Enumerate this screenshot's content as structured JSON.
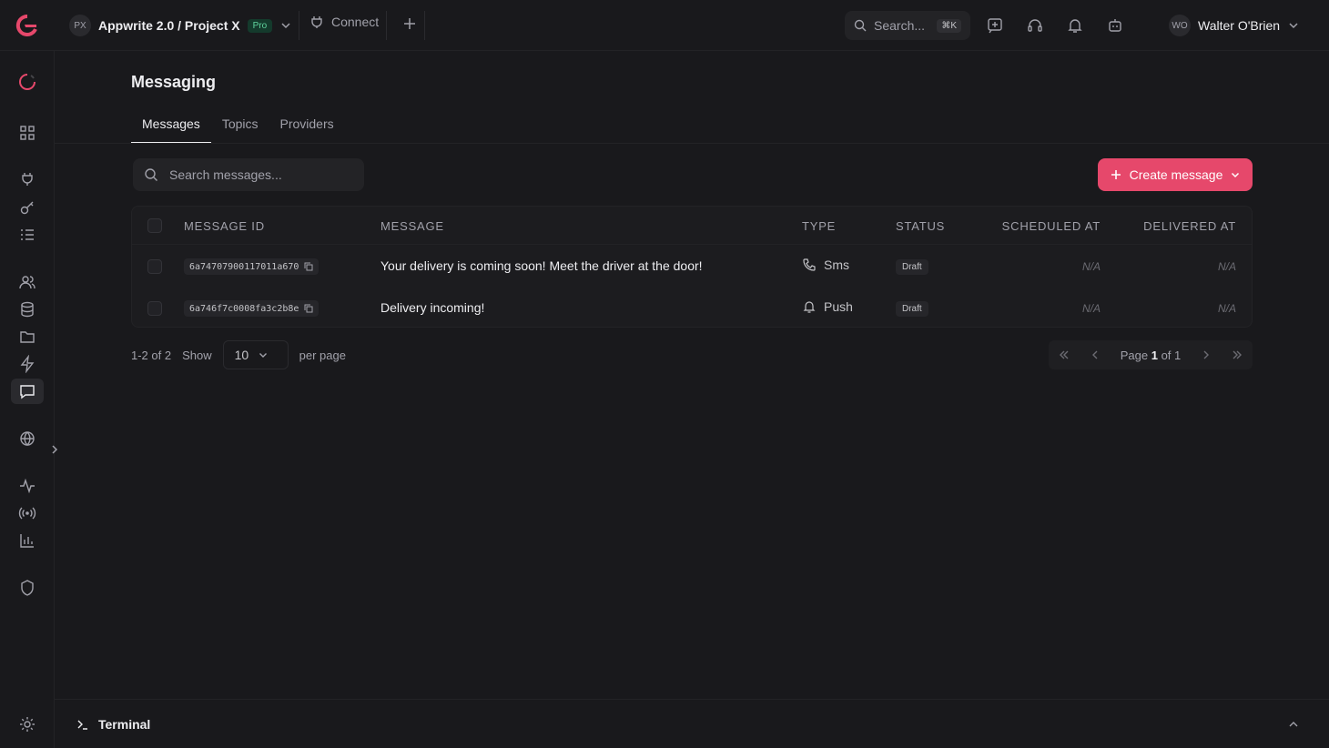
{
  "header": {
    "project_initials": "PX",
    "project_name": "Appwrite 2.0 / Project X",
    "plan_badge": "Pro",
    "connect_label": "Connect",
    "search_placeholder": "Search...",
    "search_shortcut": "⌘K",
    "user_initials": "WO",
    "user_name": "Walter O'Brien"
  },
  "page": {
    "title": "Messaging",
    "tabs": [
      {
        "label": "Messages",
        "active": true
      },
      {
        "label": "Topics",
        "active": false
      },
      {
        "label": "Providers",
        "active": false
      }
    ],
    "search_placeholder": "Search messages...",
    "create_label": "Create message"
  },
  "table": {
    "columns": [
      "MESSAGE ID",
      "MESSAGE",
      "TYPE",
      "STATUS",
      "SCHEDULED AT",
      "DELIVERED AT"
    ],
    "rows": [
      {
        "id": "6a74707900117011a670",
        "message": "Your delivery is coming soon! Meet the driver at the door!",
        "type": "Sms",
        "status": "Draft",
        "scheduled": "N/A",
        "delivered": "N/A"
      },
      {
        "id": "6a746f7c0008fa3c2b8e",
        "message": "Delivery incoming!",
        "type": "Push",
        "status": "Draft",
        "scheduled": "N/A",
        "delivered": "N/A"
      }
    ]
  },
  "pagination": {
    "range": "1-2 of 2",
    "show_label": "Show",
    "per_page_value": "10",
    "per_page_label": "per page",
    "page_label": "Page",
    "current_page": "1",
    "of_label": "of 1"
  },
  "terminal": {
    "label": "Terminal"
  },
  "colors": {
    "accent": "#e6486b",
    "background": "#19191c"
  }
}
